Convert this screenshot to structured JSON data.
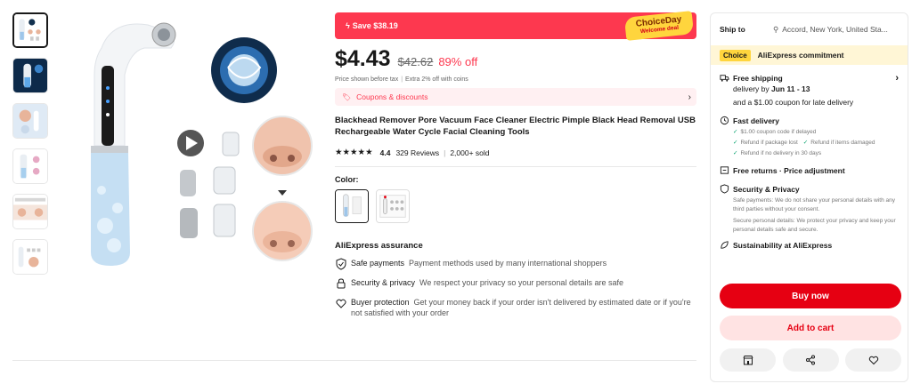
{
  "gallery": {
    "thumbnail_count": 6,
    "active_index": 0
  },
  "promo": {
    "save_text": "Save $38.19",
    "badge_line1": "ChoiceDay",
    "badge_line2": "Welcome deal"
  },
  "price": {
    "current": "$4.43",
    "original": "$42.62",
    "discount": "89% off",
    "note_1": "Price shown before tax",
    "note_2": "Extra 2% off with coins"
  },
  "coupons": {
    "label": "Coupons & discounts"
  },
  "product": {
    "title": "Blackhead Remover Pore Vacuum Face Cleaner Electric Pimple Black Head Removal USB Rechargeable Water Cycle Facial Cleaning Tools",
    "rating": "4.4",
    "stars_filled": 4.4,
    "reviews": "329 Reviews",
    "sold": "2,000+ sold"
  },
  "color": {
    "label": "Color:",
    "selected_index": 0
  },
  "assurance": {
    "title": "AliExpress assurance",
    "items": [
      {
        "label": "Safe payments",
        "desc": "Payment methods used by many international shoppers",
        "icon": "shield-check-icon"
      },
      {
        "label": "Security & privacy",
        "desc": "We respect your privacy so your personal details are safe",
        "icon": "lock-icon"
      },
      {
        "label": "Buyer protection",
        "desc": "Get your money back if your order isn't delivered by estimated date or if you're not satisfied with your order",
        "icon": "heart-shield-icon"
      }
    ]
  },
  "panel": {
    "ship_to_label": "Ship to",
    "location": "Accord, New York, United Sta...",
    "choice_tag": "Choice",
    "commitment": "AliExpress commitment",
    "free_shipping": "Free shipping",
    "delivery_prefix": "delivery by ",
    "delivery_dates": "Jun 11 - 13",
    "late_coupon": "and a $1.00 coupon for late delivery",
    "fast_delivery": "Fast delivery",
    "fast_items": [
      "$1.00 coupon code if delayed",
      "Refund if package lost",
      "Refund if items damaged",
      "Refund if no delivery in 30 days"
    ],
    "free_returns": "Free returns · Price adjustment",
    "security_title": "Security & Privacy",
    "security_text_1": "Safe payments: We do not share your personal details with any third parties without your consent.",
    "security_text_2": "Secure personal details: We protect your privacy and keep your personal details safe and secure.",
    "sustainability": "Sustainability at AliExpress",
    "buy_now": "Buy now",
    "add_to_cart": "Add to cart"
  },
  "colors": {
    "brand_red": "#fd384f",
    "buy_red": "#e60012",
    "choice_yellow": "#ffd53d"
  }
}
